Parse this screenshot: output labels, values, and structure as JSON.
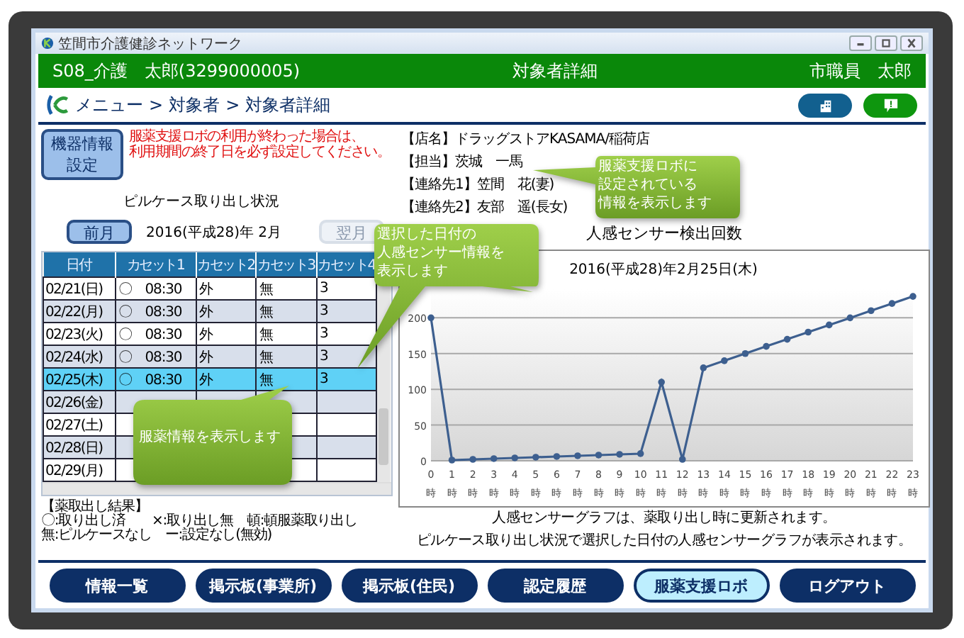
{
  "window": {
    "title": "笠間市介護健診ネットワーク"
  },
  "header": {
    "patient": "S08_介護　太郎(3299000005)",
    "page_title": "対象者詳細",
    "user": "市職員　太郎"
  },
  "breadcrumb": [
    "メニュー",
    ">",
    "対象者",
    ">",
    "対象者詳細"
  ],
  "device_settings_button": "機器情報設定",
  "notice": [
    "服薬支援ロボの利用が終わった場合は、",
    "利用期間の終了日を必ず設定してください。"
  ],
  "pillcase": {
    "title": "ピルケース取り出し状況",
    "prev_button": {
      "label": "前月",
      "disabled": false
    },
    "month": "2016(平成28)年 2月",
    "next_button": {
      "label": "翌月",
      "disabled": true
    },
    "columns": [
      "日付",
      "カセット1",
      "カセット2",
      "カセット3",
      "カセット4"
    ],
    "rows": [
      {
        "cells": [
          "02/21(日)",
          "〇　08:30",
          "外",
          "無",
          "3"
        ],
        "selected": false
      },
      {
        "cells": [
          "02/22(月)",
          "〇　08:30",
          "外",
          "無",
          "3"
        ],
        "selected": false
      },
      {
        "cells": [
          "02/23(火)",
          "〇　08:30",
          "外",
          "無",
          "3"
        ],
        "selected": false
      },
      {
        "cells": [
          "02/24(水)",
          "〇　08:30",
          "外",
          "無",
          "3"
        ],
        "selected": false
      },
      {
        "cells": [
          "02/25(木)",
          "〇　08:30",
          "外",
          "無",
          "3"
        ],
        "selected": true
      },
      {
        "cells": [
          "02/26(金)"
        ],
        "selected": false
      },
      {
        "cells": [
          "02/27(土)"
        ],
        "selected": false
      },
      {
        "cells": [
          "02/28(日)"
        ],
        "selected": false
      },
      {
        "cells": [
          "02/29(月)"
        ],
        "selected": false
      }
    ],
    "legend": [
      "【薬取出し結果】",
      "〇:取り出し済　　×:取り出し無　頓:頓服薬取り出し",
      "無:ピルケースなし　ー:設定なし(無効)"
    ]
  },
  "store_info": [
    "【店名】ドラッグストアKASAMA/稲荷店",
    "【担当】茨城　一馬",
    "【連絡先1】笠間　花(妻)",
    "【連絡先2】友部　遥(長女)"
  ],
  "sensor_chart": {
    "title": "人感センサー検出回数",
    "date": "2016(平成28)年2月25日(木)",
    "chart_data": {
      "type": "line",
      "categories": [
        "0時",
        "1時",
        "2時",
        "3時",
        "4時",
        "5時",
        "6時",
        "7時",
        "8時",
        "9時",
        "10時",
        "11時",
        "12時",
        "13時",
        "14時",
        "15時",
        "16時",
        "17時",
        "18時",
        "19時",
        "20時",
        "21時",
        "22時",
        "23時"
      ],
      "grid": true,
      "series": [
        {
          "color": "#3d5f8f",
          "marker": "circle",
          "values": [
            200,
            1,
            2,
            3,
            4,
            5,
            6,
            7,
            8,
            9,
            10,
            110,
            2,
            130,
            140,
            150,
            160,
            170,
            180,
            190,
            200,
            210,
            220,
            230
          ]
        }
      ],
      "ylim": [
        0,
        240
      ],
      "yticks": [
        0,
        50,
        100,
        150,
        200
      ]
    },
    "notes": [
      "人感センサーグラフは、薬取り出し時に更新されます。",
      "ピルケース取り出し状況で選択した日付の人感センサーグラフが表示されます。"
    ]
  },
  "callouts": [
    {
      "lines": [
        "服薬支援ロボに",
        "設定されている",
        "情報を表示します"
      ]
    },
    {
      "lines": [
        "選択した日付の",
        "人感センサー情報を",
        "表示します"
      ]
    },
    {
      "lines": [
        "服薬情報を表示します"
      ]
    }
  ],
  "nav_buttons": [
    {
      "label": "情報一覧",
      "selected": false
    },
    {
      "label": "掲示板(事業所)",
      "selected": false
    },
    {
      "label": "掲示板(住民)",
      "selected": false
    },
    {
      "label": "認定履歴",
      "selected": false
    },
    {
      "label": "服薬支援ロボ",
      "selected": true
    },
    {
      "label": "ログアウト",
      "selected": false
    }
  ]
}
